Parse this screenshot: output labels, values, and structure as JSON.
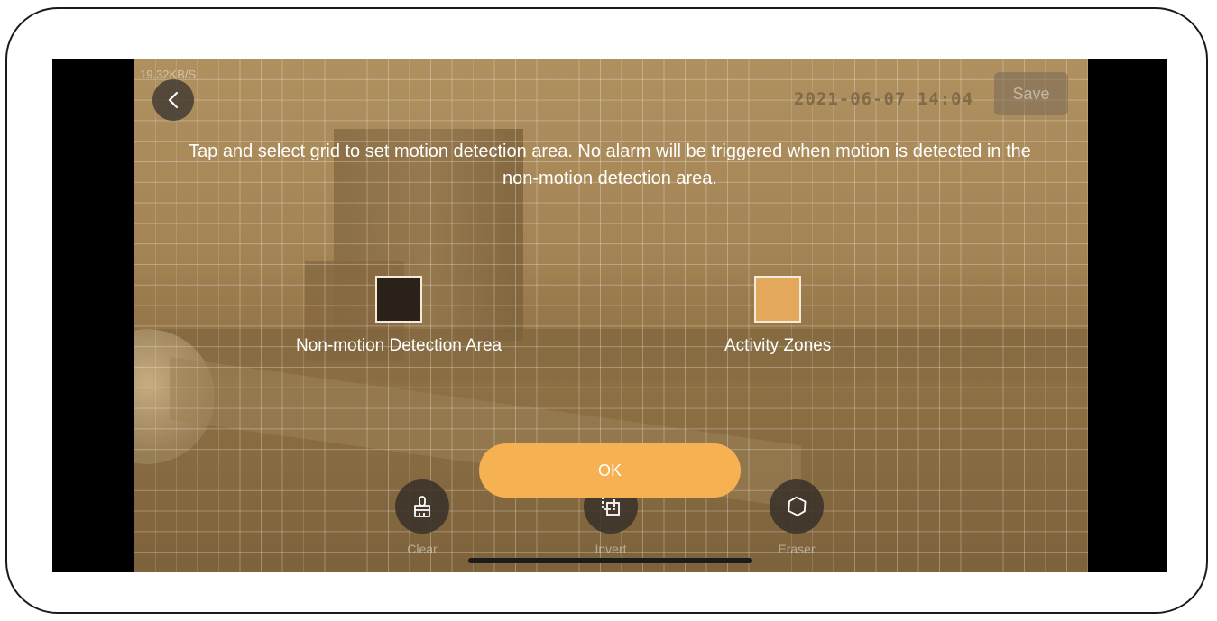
{
  "status": {
    "bitrate": "19.32KB/S"
  },
  "header": {
    "timestamp": "2021-06-07 14:04",
    "save_label": "Save",
    "back_icon": "chevron-left-icon"
  },
  "instruction": {
    "line1": "Tap and select grid to set motion detection area. No alarm will be triggered when motion is detected in the",
    "line2": "non-motion detection area."
  },
  "legend": {
    "non_motion": {
      "label": "Non-motion Detection Area",
      "color": "#2a2118"
    },
    "activity": {
      "label": "Activity Zones",
      "color": "#e4a85d"
    }
  },
  "ok_button": {
    "label": "OK",
    "color": "#f6b152"
  },
  "tools": [
    {
      "label": "Clear",
      "icon": "brush-icon"
    },
    {
      "label": "Invert",
      "icon": "invert-icon"
    },
    {
      "label": "Eraser",
      "icon": "eraser-icon"
    }
  ]
}
